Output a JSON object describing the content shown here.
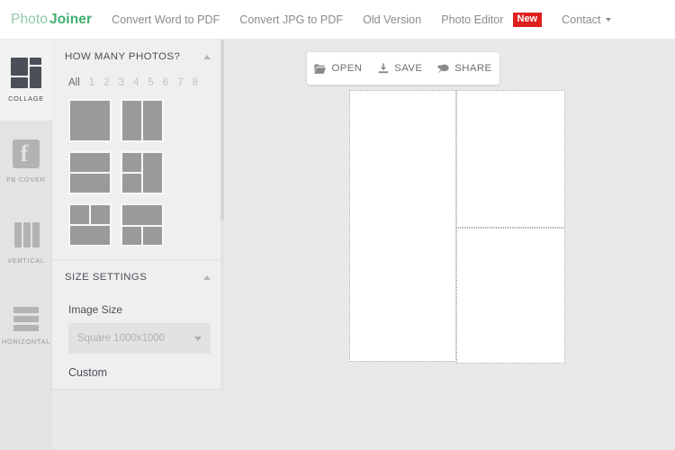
{
  "nav": {
    "brand_first": "Photo",
    "brand_second": "Joiner",
    "links": [
      {
        "label": "Convert Word to PDF"
      },
      {
        "label": "Convert JPG to PDF"
      },
      {
        "label": "Old Version"
      },
      {
        "label": "Photo Editor"
      }
    ],
    "badge": "New",
    "contact": "Contact",
    "accent_green_light": "#8fc9a8",
    "accent_green_dark": "#3fae6e",
    "badge_color": "#e01f1f"
  },
  "rail": {
    "items": [
      {
        "label": "COLLAGE",
        "icon": "collage-icon",
        "active": true
      },
      {
        "label": "FB COVER",
        "icon": "facebook-icon",
        "active": false
      },
      {
        "label": "VERTICAL",
        "icon": "vertical-bars-icon",
        "active": false
      },
      {
        "label": "HORIZONTAL",
        "icon": "horizontal-bars-icon",
        "active": false
      }
    ]
  },
  "panel": {
    "photos_section": {
      "title": "HOW MANY PHOTOS?",
      "collapse_icon": "chevron-up-icon",
      "counts": [
        "All",
        "1",
        "2",
        "3",
        "4",
        "5",
        "6",
        "7",
        "8"
      ],
      "selected_count": "All",
      "layouts": [
        {
          "name": "layout-1-single"
        },
        {
          "name": "layout-2-vertical-split"
        },
        {
          "name": "layout-2-horizontal-split"
        },
        {
          "name": "layout-3-left-split"
        },
        {
          "name": "layout-3-top-split"
        },
        {
          "name": "layout-3-bottom-split"
        }
      ]
    },
    "size_section": {
      "title": "SIZE SETTINGS",
      "collapse_icon": "chevron-up-icon",
      "image_size_label": "Image Size",
      "image_size_value": "Square 1000x1000",
      "dropdown_icon": "caret-down-icon",
      "custom_label": "Custom",
      "custom_width": "",
      "custom_height": ""
    }
  },
  "toolbar": {
    "buttons": [
      {
        "label": "OPEN",
        "icon": "folder-open-icon"
      },
      {
        "label": "SAVE",
        "icon": "download-icon"
      },
      {
        "label": "SHARE",
        "icon": "speech-bubble-icon"
      }
    ]
  },
  "canvas": {
    "cells": [
      {
        "name": "cell-left"
      },
      {
        "name": "cell-right-top"
      },
      {
        "name": "cell-right-bottom"
      }
    ]
  }
}
